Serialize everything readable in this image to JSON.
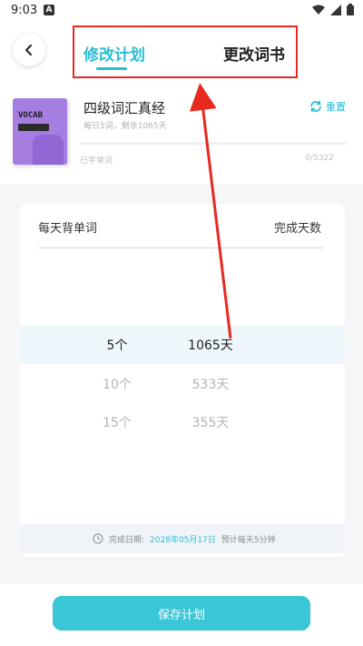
{
  "status_bar": {
    "time": "9:03",
    "notif_letter": "A"
  },
  "tabs": {
    "plan": "修改计划",
    "book": "更改词书"
  },
  "book": {
    "cover_text": "VOCAB",
    "title": "四级词汇真经",
    "subtitle": "每日5词，剩余1065天",
    "reset_label": "重置",
    "learned_label": "已学单词",
    "learned_count": "0/5322",
    "progress": 0
  },
  "picker": {
    "left_header": "每天背单词",
    "right_header": "完成天数",
    "rows": [
      {
        "count": "5个",
        "days": "1065天"
      },
      {
        "count": "10个",
        "days": "533天"
      },
      {
        "count": "15个",
        "days": "355天"
      }
    ],
    "selected_index": 0
  },
  "footer": {
    "finish_label": "完成日期:",
    "finish_date": "2028年05月17日",
    "estimate": "预计每天5分钟"
  },
  "save_button": "保存计划",
  "colors": {
    "accent": "#2bbdd4",
    "button": "#3ac6d6",
    "annotation": "#e8291f"
  }
}
